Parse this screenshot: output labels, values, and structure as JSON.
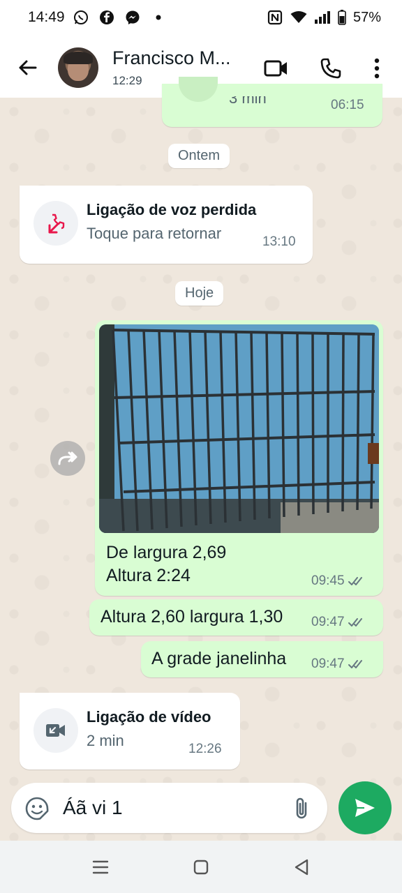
{
  "status_bar": {
    "time": "14:49",
    "battery": "57%",
    "left_icons": [
      "whatsapp-icon",
      "facebook-icon",
      "messenger-icon",
      "dot-icon"
    ],
    "right_icons": [
      "nfc-icon",
      "wifi-icon",
      "signal-icon",
      "battery-icon"
    ]
  },
  "header": {
    "contact_name": "Francisco M...",
    "last_seen": "12:29",
    "icons": [
      "back-arrow-icon",
      "video-call-icon",
      "phone-icon",
      "more-icon"
    ]
  },
  "chat": {
    "top_partial": {
      "text": "3 min",
      "time": "06:15"
    },
    "date_yesterday": "Ontem",
    "missed_call": {
      "title": "Ligação de voz perdida",
      "subtitle": "Toque para retornar",
      "time": "13:10",
      "accent": "#e8174b"
    },
    "date_today": "Hoje",
    "image_message": {
      "line1": "De largura 2,69",
      "line2": "Altura 2:24",
      "time": "09:45"
    },
    "messages": [
      {
        "text": "Altura 2,60 largura 1,30",
        "time": "09:47"
      },
      {
        "text": "A grade janelinha",
        "time": "09:47"
      }
    ],
    "video_call": {
      "title": "Ligação de vídeo",
      "subtitle": "2 min",
      "time": "12:26"
    }
  },
  "composer": {
    "text": "Áã vi 1",
    "send_color": "#1daa61"
  },
  "colors": {
    "outgoing_bubble": "#d9fdd3",
    "incoming_bubble": "#ffffff",
    "read_tick": "#667781"
  }
}
